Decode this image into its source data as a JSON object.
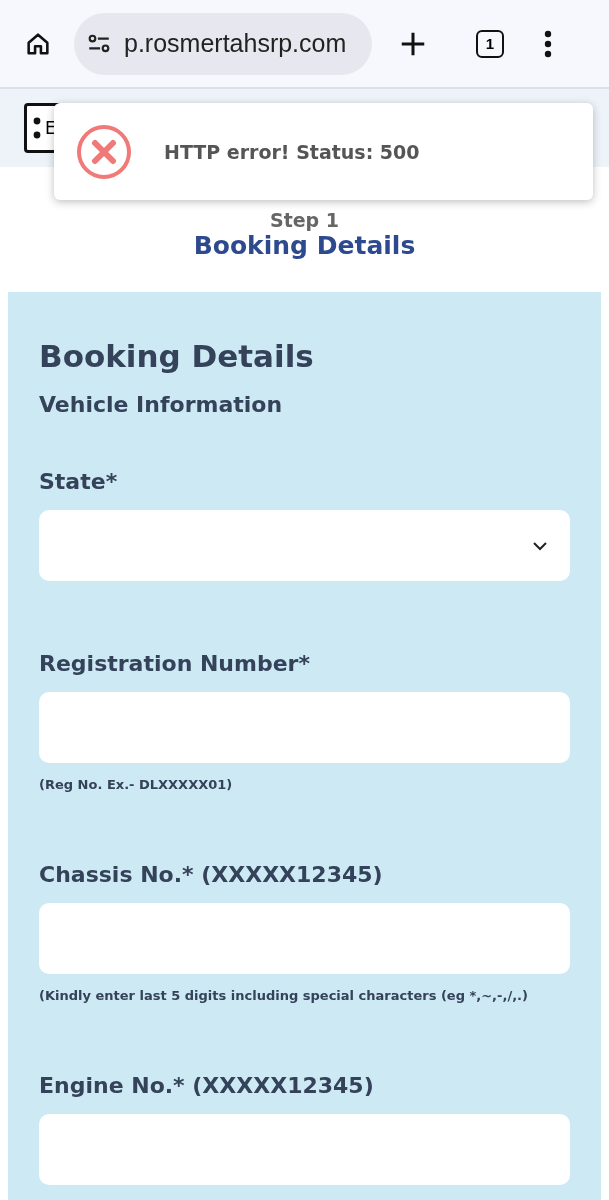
{
  "browser": {
    "url": "p.rosmertahsrp.com",
    "tab_count": "1"
  },
  "header": {
    "button_label": "E"
  },
  "toast": {
    "message": "HTTP error! Status: 500"
  },
  "stepper": {
    "step": "Step 1",
    "title": "Booking Details"
  },
  "form": {
    "title": "Booking Details",
    "section": "Vehicle Information",
    "fields": [
      {
        "kind": "select",
        "label": "State*"
      },
      {
        "kind": "text",
        "label": "Registration Number*",
        "hint": "(Reg No. Ex.- DLXXXXX01)"
      },
      {
        "kind": "text",
        "label": "Chassis No.* (XXXXX12345)",
        "hint": "(Kindly enter last 5 digits including special characters (eg *,~,-,/,.)"
      },
      {
        "kind": "text",
        "label": "Engine No.* (XXXXX12345)"
      }
    ]
  }
}
